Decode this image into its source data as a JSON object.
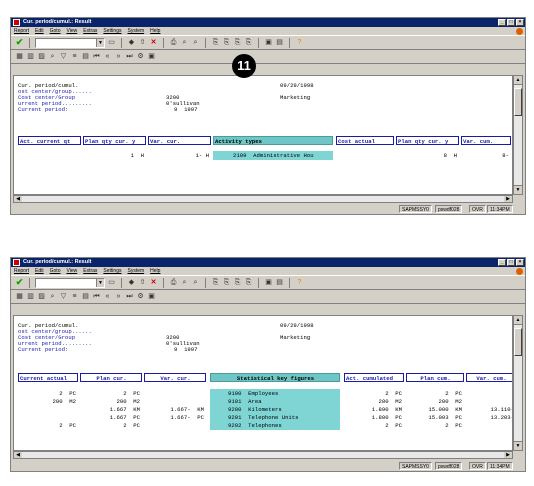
{
  "callout": "11",
  "windows": [
    {
      "title": "Cur. period/cumul.: Result",
      "menu": [
        "Report",
        "Edit",
        "Goto",
        "View",
        "Extras",
        "Settings",
        "System",
        "Help"
      ],
      "header": {
        "line1_label": "Cur. period/cumul.",
        "line1_date": "09/29/1998",
        "line2_label": "ost center/group......",
        "line3_label": "Cost center/Group",
        "line3_value": "3200",
        "line3_name": "Marketing",
        "line4_label": "urrent period.........",
        "line4_value": "0'sullivan",
        "line5_label": "Current period:",
        "line5_value": "9  1997"
      },
      "columns": [
        "Act. current qt",
        "Plan qty cur. y",
        "Var. cur.",
        "Activity types",
        "Cost actual",
        "Plan qty cur. y",
        "Var. cum."
      ],
      "rows": [
        [
          "",
          "1  H",
          "1- H",
          "2109  Administrative Hou",
          "",
          "8  H",
          "8-"
        ]
      ],
      "status": {
        "system": "SAPMSSY0",
        "client": "pswdf028",
        "mode": "OVR",
        "time": "11:34PM"
      }
    },
    {
      "title": "Cur. period/cumul.: Result",
      "menu": [
        "Report",
        "Edit",
        "Goto",
        "View",
        "Extras",
        "Settings",
        "System",
        "Help"
      ],
      "header": {
        "line1_label": "Cur. period/cumul.",
        "line1_date": "09/29/1998",
        "line2_label": "ost center/group......",
        "line3_label": "Cost center/Group",
        "line3_value": "3200",
        "line3_name": "Marketing",
        "line4_label": "urrent period.........",
        "line4_value": "0'sullivan",
        "line5_label": "Current period:",
        "line5_value": "9  1997"
      },
      "columns": [
        "Current actual",
        "Plan cur.",
        "Var. cur.",
        "Statistical key figures",
        "Act. cumulated",
        "Plan cum.",
        "Var. cum."
      ],
      "rows": [
        [
          "2  PC",
          "2  PC",
          "",
          "9100  Employees",
          "2  PC",
          "2  PC",
          ""
        ],
        [
          "200  M2",
          "200  M2",
          "",
          "9101  Area",
          "200  M2",
          "200  M2",
          ""
        ],
        [
          "",
          "1.667  KM",
          "1.667-  KM",
          "9200  Kilometers",
          "1.890  KM",
          "15.000  KM",
          "13.110-"
        ],
        [
          "",
          "1.667  PC",
          "1.667-  PC",
          "9201  Telephone Units",
          "1.800  PC",
          "15.003  PC",
          "13.203-"
        ],
        [
          "2  PC",
          "2  PC",
          "",
          "9202  Telephones",
          "2  PC",
          "2  PC",
          ""
        ]
      ],
      "status": {
        "system": "SAPMSSY0",
        "client": "pswdf028",
        "mode": "OVR",
        "time": "11:34PM"
      }
    }
  ]
}
